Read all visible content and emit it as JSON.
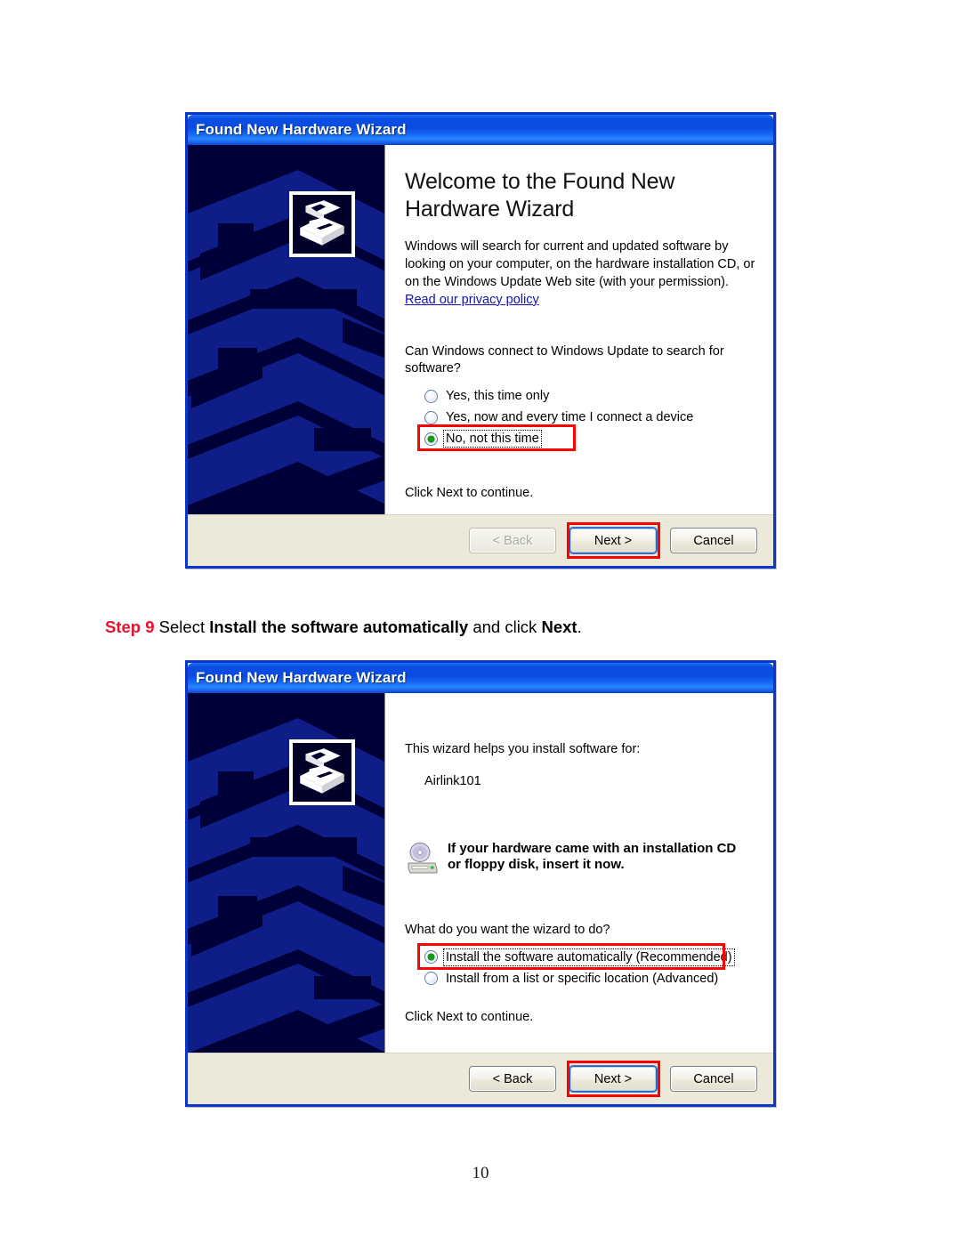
{
  "document": {
    "page_number": "10"
  },
  "step_caption": {
    "step_label": "Step 9",
    "text_part1": " Select ",
    "bold1": "Install the software automatically",
    "text_part2": " and click ",
    "bold2": "Next",
    "text_part3": "."
  },
  "colors": {
    "step_number_red": "#e8112d",
    "annotation_red": "#ff0000",
    "titlebar_blue": "#0a4fe0",
    "sidebar_navy": "#000038",
    "footer_beige": "#ECE9D8",
    "link_blue": "#1111bb",
    "radio_green": "#14a014"
  },
  "dialog1": {
    "title": "Found New Hardware Wizard",
    "icon_name": "wizard-hardware-icon",
    "heading": "Welcome to the Found New Hardware Wizard",
    "paragraph": "Windows will search for current and updated software by looking on your computer, on the hardware installation CD, or on the Windows Update Web site (with your permission).",
    "privacy_link": "Read our privacy policy",
    "question": "Can Windows connect to Windows Update to search for software?",
    "options": [
      {
        "label": "Yes, this time only",
        "selected": false
      },
      {
        "label": "Yes, now and every time I connect a device",
        "selected": false
      },
      {
        "label": "No, not this time",
        "selected": true
      }
    ],
    "footer_text": "Click Next to continue.",
    "buttons": [
      {
        "label": "< Back",
        "state": "disabled",
        "highlighted": false
      },
      {
        "label": "Next >",
        "state": "default",
        "highlighted": true
      },
      {
        "label": "Cancel",
        "state": "normal",
        "highlighted": false
      }
    ]
  },
  "dialog2": {
    "title": "Found New Hardware Wizard",
    "icon_name": "wizard-hardware-icon",
    "intro": "This wizard helps you install software for:",
    "device_name": "Airlink101",
    "cd_icon_name": "cd-drive-icon",
    "cd_notice_line1": "If your hardware came with an installation CD",
    "cd_notice_line2": "or floppy disk, insert it now.",
    "question": "What do you want the wizard to do?",
    "options": [
      {
        "label": "Install the software automatically (Recommended)",
        "selected": true
      },
      {
        "label": "Install from a list or specific location (Advanced)",
        "selected": false
      }
    ],
    "footer_text": "Click Next to continue.",
    "buttons": [
      {
        "label": "< Back",
        "state": "normal",
        "highlighted": false
      },
      {
        "label": "Next >",
        "state": "default",
        "highlighted": true
      },
      {
        "label": "Cancel",
        "state": "normal",
        "highlighted": false
      }
    ]
  }
}
